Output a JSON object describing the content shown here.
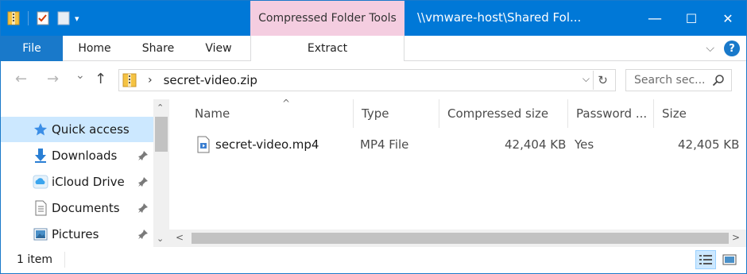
{
  "window": {
    "context_tab_header": "Compressed Folder Tools",
    "title": "\\\\vmware-host\\Shared Fol...",
    "controls": {
      "minimize": "—",
      "maximize": "☐",
      "close": "✕"
    }
  },
  "ribbon": {
    "tabs": [
      {
        "label": "File"
      },
      {
        "label": "Home"
      },
      {
        "label": "Share"
      },
      {
        "label": "View"
      },
      {
        "label": "Extract"
      }
    ],
    "expand_glyph": "⌵",
    "help_glyph": "?"
  },
  "navigation": {
    "back_glyph": "←",
    "forward_glyph": "→",
    "recent_glyph": "⌄",
    "up_glyph": "↑",
    "address": {
      "separator": "›",
      "path": "secret-video.zip",
      "dropdown_glyph": "⌵",
      "refresh_glyph": "↻"
    },
    "search": {
      "placeholder": "Search sec..."
    }
  },
  "sidebar": {
    "items": [
      {
        "label": "Quick access",
        "icon": "star-icon",
        "pinned": false,
        "selected": true
      },
      {
        "label": "Downloads",
        "icon": "download-icon",
        "pinned": true,
        "selected": false
      },
      {
        "label": "iCloud Drive",
        "icon": "cloud-icon",
        "pinned": true,
        "selected": false
      },
      {
        "label": "Documents",
        "icon": "document-icon",
        "pinned": true,
        "selected": false
      },
      {
        "label": "Pictures",
        "icon": "pictures-icon",
        "pinned": true,
        "selected": false
      }
    ],
    "scroll_up": "⌃",
    "scroll_down": "⌄"
  },
  "file_list": {
    "columns": [
      "Name",
      "Type",
      "Compressed size",
      "Password ...",
      "Size"
    ],
    "sort_glyph": "^",
    "rows": [
      {
        "name": "secret-video.mp4",
        "type": "MP4 File",
        "compressed_size": "42,404 KB",
        "password": "Yes",
        "size": "42,405 KB"
      }
    ],
    "scroll_left": "<",
    "scroll_right": ">"
  },
  "status": {
    "item_count": "1 item"
  },
  "colors": {
    "titlebar": "#0078d7",
    "file_tab": "#1979ca",
    "context_tab": "#f4cde0",
    "selection": "#cce8ff",
    "folder": "#f5c342"
  }
}
